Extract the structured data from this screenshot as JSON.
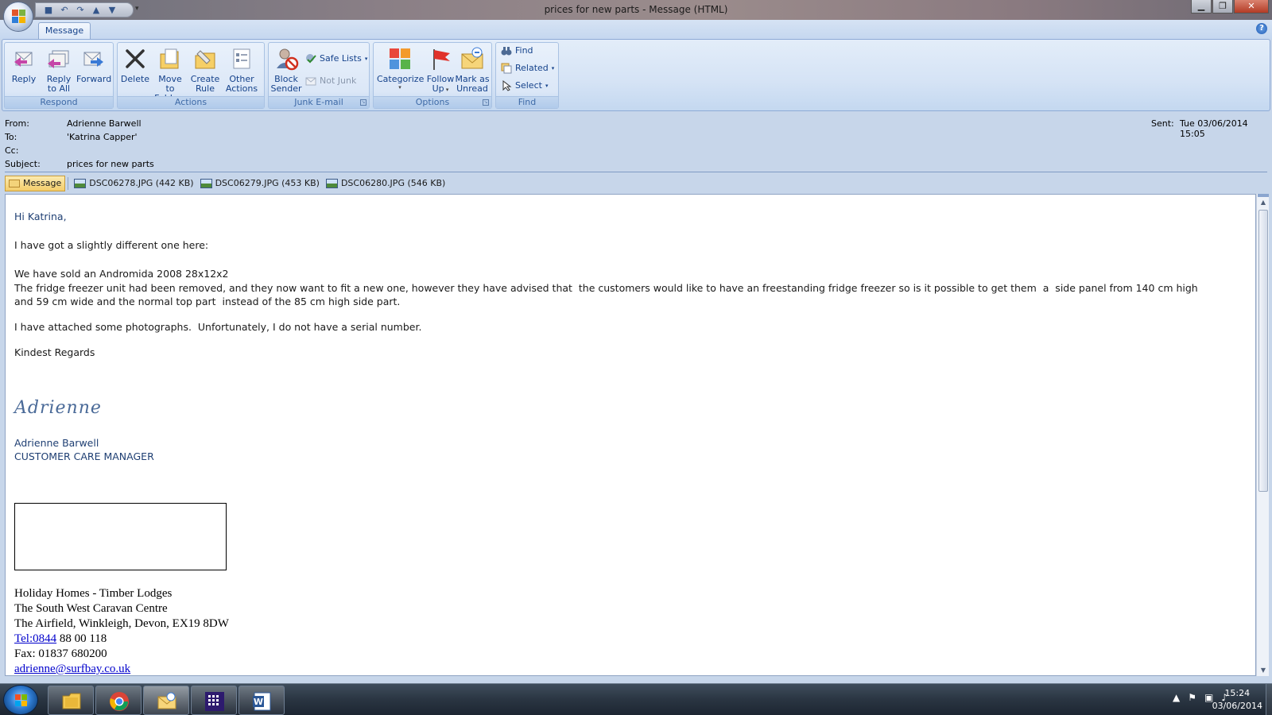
{
  "window": {
    "title": "prices for new parts - Message (HTML)",
    "minimize": "▁",
    "maximize": "❐",
    "close": "✕"
  },
  "tabs": [
    {
      "label": "Message"
    }
  ],
  "ribbon": {
    "groups": {
      "respond": {
        "label": "Respond"
      },
      "actions": {
        "label": "Actions"
      },
      "junk": {
        "label": "Junk E-mail"
      },
      "options": {
        "label": "Options"
      },
      "find": {
        "label": "Find"
      }
    },
    "reply": "Reply",
    "reply_all_1": "Reply",
    "reply_all_2": "to All",
    "forward": "Forward",
    "delete": "Delete",
    "move_1": "Move to",
    "move_2": "Folder",
    "create_1": "Create",
    "create_2": "Rule",
    "other_1": "Other",
    "other_2": "Actions",
    "block_1": "Block",
    "block_2": "Sender",
    "safe_lists": "Safe Lists",
    "not_junk": "Not Junk",
    "categorize": "Categorize",
    "follow_1": "Follow",
    "follow_2": "Up",
    "mark_1": "Mark as",
    "mark_2": "Unread",
    "find": "Find",
    "related": "Related",
    "select": "Select"
  },
  "header": {
    "from_label": "From:",
    "from": "Adrienne Barwell",
    "to_label": "To:",
    "to": "'Katrina Capper'",
    "cc_label": "Cc:",
    "cc": "",
    "subject_label": "Subject:",
    "subject": "prices for new parts",
    "sent_label": "Sent:",
    "sent": "Tue 03/06/2014 15:05"
  },
  "attachments": {
    "message_tab": "Message",
    "files": [
      {
        "name": "DSC06278.JPG (442 KB)"
      },
      {
        "name": "DSC06279.JPG (453 KB)"
      },
      {
        "name": "DSC06280.JPG (546 KB)"
      }
    ]
  },
  "body": {
    "greeting": "Hi Katrina,",
    "line1": "I have got a slightly different one here:",
    "line2": "We have sold an Andromida 2008 28x12x2",
    "line3a": "The fridge freezer unit had been removed, and they now want to fit a new one, however they have advised that  the customers would like to have an freestanding fridge freezer so is it possible to get them  a  side panel from 140 cm high",
    "line3b": "and 59 cm wide and the normal top part  instead of the 85 cm high side part.",
    "line4": "I have attached some photographs.  Unfortunately, I do not have a serial number.",
    "closing": "Kindest Regards",
    "signature_script": "Adrienne",
    "sig_name": "Adrienne Barwell",
    "sig_title": "CUSTOMER CARE MANAGER",
    "company1": "Holiday Homes - Timber Lodges",
    "company2": "The South West Caravan Centre",
    "address": "The Airfield, Winkleigh, Devon, EX19 8DW",
    "tel_link": "Tel:0844",
    "tel_rest": " 88 00 118",
    "fax": "Fax: 01837 680200",
    "email": "adrienne@surfbay.co.uk"
  },
  "taskbar": {
    "time": "15:24",
    "date": "03/06/2014"
  },
  "colors": {
    "ribbon_text": "#15428b",
    "group_label": "#3e6aa7",
    "body_blue": "#1f3f73",
    "link": "#0000cc"
  }
}
